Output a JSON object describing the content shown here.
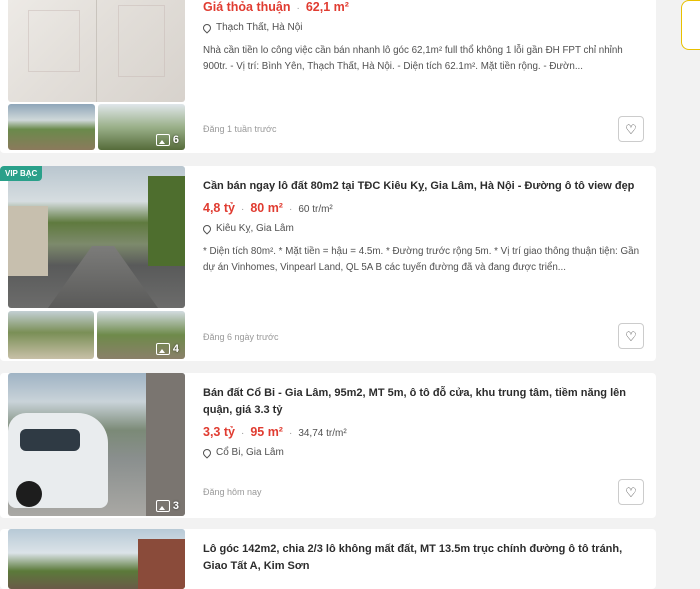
{
  "listings": [
    {
      "title": "",
      "price": "Giá thỏa thuận",
      "area": "62,1 m²",
      "price_per_m2": "",
      "location": "Thạch Thất, Hà Nội",
      "description": "Nhà cần tiền lo công việc cần bán nhanh lô góc 62,1m² full thổ không 1 lỗi gần ĐH FPT chỉ nhỉnh 900tr. - Vị trí: Bình Yên, Thạch Thất, Hà Nội. - Diện tích 62.1m². Mặt tiền rộng. - Đườn...",
      "posted": "Đăng 1 tuần trước",
      "photo_count": "6",
      "badge": ""
    },
    {
      "title": "Cần bán ngay lô đất 80m2 tại TĐC Kiêu Kỵ, Gia Lâm, Hà Nội - Đường ô tô view đẹp",
      "price": "4,8 tỷ",
      "area": "80 m²",
      "price_per_m2": "60 tr/m²",
      "location": "Kiêu Kỵ, Gia Lâm",
      "description": "* Diện tích 80m². * Mặt tiền = hậu = 4.5m. * Đường trước rộng 5m. * Vị trí giao thông thuận tiện: Gần dự án Vinhomes, Vinpearl Land, QL 5A B các tuyến đường đã và đang được triển...",
      "posted": "Đăng 6 ngày trước",
      "photo_count": "4",
      "badge": "VIP BẠC"
    },
    {
      "title": "Bán đất Cổ Bi - Gia Lâm, 95m2, MT 5m, ô tô đỗ cửa, khu trung tâm, tiềm năng lên quận, giá 3.3 tỷ",
      "price": "3,3 tỷ",
      "area": "95 m²",
      "price_per_m2": "34,74 tr/m²",
      "location": "Cổ Bi, Gia Lâm",
      "description": "",
      "posted": "Đăng hôm nay",
      "photo_count": "3",
      "badge": ""
    },
    {
      "title": "Lô góc 142m2, chia 2/3 lô không mất đất, MT 13.5m trục chính đường ô tô tránh, Giao Tất A, Kim Sơn",
      "price": "",
      "area": "",
      "price_per_m2": "",
      "location": "",
      "description": "",
      "posted": "",
      "photo_count": "",
      "badge": ""
    }
  ],
  "icons": {
    "save": "heart-icon",
    "location": "location-pin-icon",
    "photos": "image-gallery-icon"
  },
  "colors": {
    "price": "#e03c31",
    "vip_badge": "#2aa08a",
    "background": "#f2f2f2"
  }
}
